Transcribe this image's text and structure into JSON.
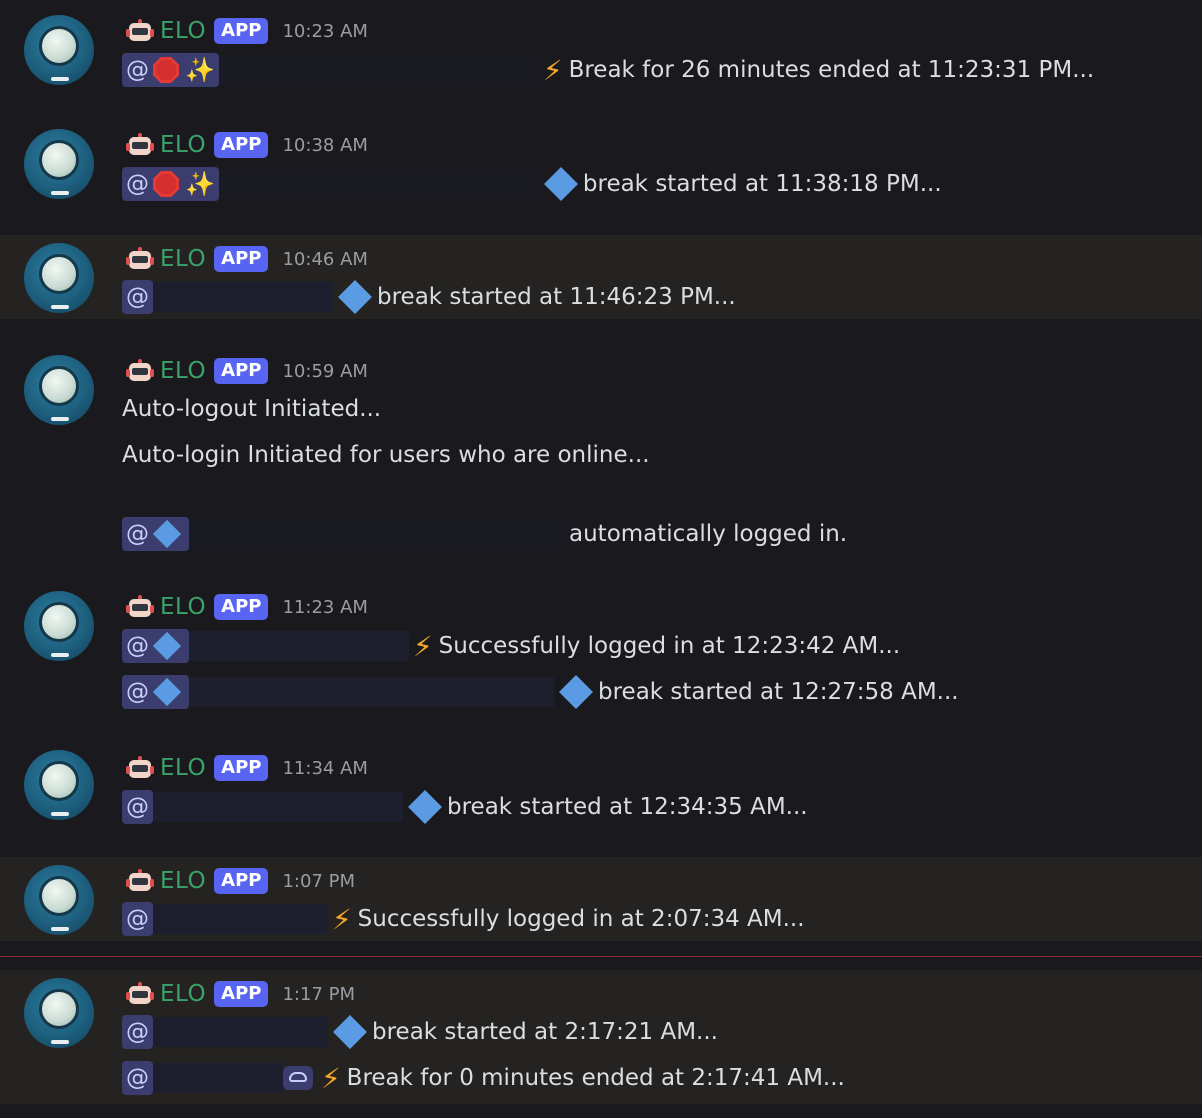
{
  "messages": [
    {
      "bot": "ELO",
      "badge": "APP",
      "time": "10:23 AM",
      "lines": [
        {
          "text": "Break for 26 minutes ended at 11:23:31 PM..."
        }
      ]
    },
    {
      "bot": "ELO",
      "badge": "APP",
      "time": "10:38 AM",
      "lines": [
        {
          "text": "break started at 11:38:18 PM..."
        }
      ]
    },
    {
      "bot": "ELO",
      "badge": "APP",
      "time": "10:46 AM",
      "lines": [
        {
          "text": "break started at 11:46:23 PM..."
        }
      ]
    },
    {
      "bot": "ELO",
      "badge": "APP",
      "time": "10:59 AM",
      "lines": [
        {
          "text": "Auto-logout Initiated..."
        },
        {
          "text": "Auto-login Initiated for users who are online..."
        },
        {
          "text": "automatically logged in."
        }
      ]
    },
    {
      "bot": "ELO",
      "badge": "APP",
      "time": "11:23 AM",
      "lines": [
        {
          "text": "Successfully logged in at 12:23:42 AM..."
        },
        {
          "text": "break started at 12:27:58 AM..."
        }
      ]
    },
    {
      "bot": "ELO",
      "badge": "APP",
      "time": "11:34 AM",
      "lines": [
        {
          "text": "break started at 12:34:35 AM..."
        }
      ]
    },
    {
      "bot": "ELO",
      "badge": "APP",
      "time": "1:07 PM",
      "lines": [
        {
          "text": "Successfully logged in at 2:07:34 AM..."
        }
      ]
    },
    {
      "bot": "ELO",
      "badge": "APP",
      "time": "1:17 PM",
      "lines": [
        {
          "text": "break started at 2:17:21 AM..."
        },
        {
          "text": "Break for 0 minutes ended at 2:17:41 AM..."
        }
      ]
    }
  ],
  "mention_symbol": "@",
  "icons": {
    "avatar": "robot-eye-avatar",
    "bot": "robot-face-icon",
    "stop": "stop-sign-icon",
    "sparkle": "sparkles-icon",
    "diamond": "blue-diamond-icon",
    "bolt": "lightning-bolt-icon"
  },
  "colors": {
    "background": "#1a1a1e",
    "highlight": "#242322",
    "name": "#3ba26b",
    "badge": "#5865f2",
    "mention_bg": "#3a3d6e",
    "new_divider": "#8b2e35"
  }
}
